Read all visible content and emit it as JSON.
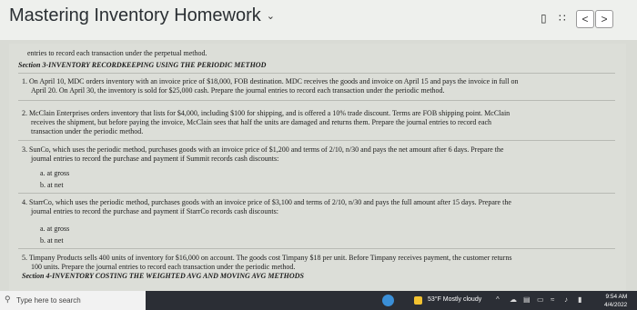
{
  "header": {
    "title": "Mastering Inventory Homework",
    "chevron_icon": "chevron-down",
    "nav_prev": "<",
    "nav_next": ">"
  },
  "doc": {
    "intro": "entries to record each transaction under the perpetual method.",
    "section": "Section 3-INVENTORY RECORDKEEPING USING THE PERIODIC METHOD",
    "q1": [
      "1. On April 10, MDC orders inventory with an invoice price of $18,000, FOB destination. MDC receives the goods and invoice on April 15 and pays the invoice in full on",
      "April 20. On April 30, the inventory is sold for $25,000 cash. Prepare the journal entries to record each transaction under the periodic method."
    ],
    "q2": [
      "2. McClain Enterprises orders inventory that lists for $4,000, including $100 for shipping, and is offered a 10% trade discount. Terms are FOB shipping point. McClain",
      "receives the shipment, but before paying the invoice, McClain sees that half the units are damaged and returns them. Prepare the journal entries to record each",
      "transaction under the periodic method."
    ],
    "q3": [
      "3. SunCo, which uses the periodic method, purchases goods with an invoice price of $1,200 and terms of 2/10, n/30 and pays the net amount after 6 days. Prepare the",
      "journal entries to record the purchase and payment if Summit records cash discounts:"
    ],
    "q3_opts": [
      "a. at gross",
      "b. at net"
    ],
    "q4": [
      "4. StarrCo, which uses the periodic method, purchases goods with an invoice price of $3,100 and terms of 2/10, n/30 and pays the full amount after 15 days. Prepare the",
      "journal entries to record the purchase and payment if StarrCo records cash discounts:"
    ],
    "q4_opts": [
      "a. at gross",
      "b. at net"
    ],
    "q5": [
      "5. Timpany Products sells 400 units of inventory for $16,000 on account. The goods cost Timpany $18 per unit. Before Timpany receives payment, the customer returns",
      "100 units. Prepare the journal entries to record each transaction under the periodic method."
    ],
    "section_next": "Section 4-INVENTORY COSTING THE WEIGHTED AVG AND MOVING AVG METHODS"
  },
  "taskbar": {
    "search_placeholder": "Type here to search",
    "weather": "53°F  Mostly cloudy",
    "time": "9:54 AM",
    "date": "4/4/2022"
  }
}
